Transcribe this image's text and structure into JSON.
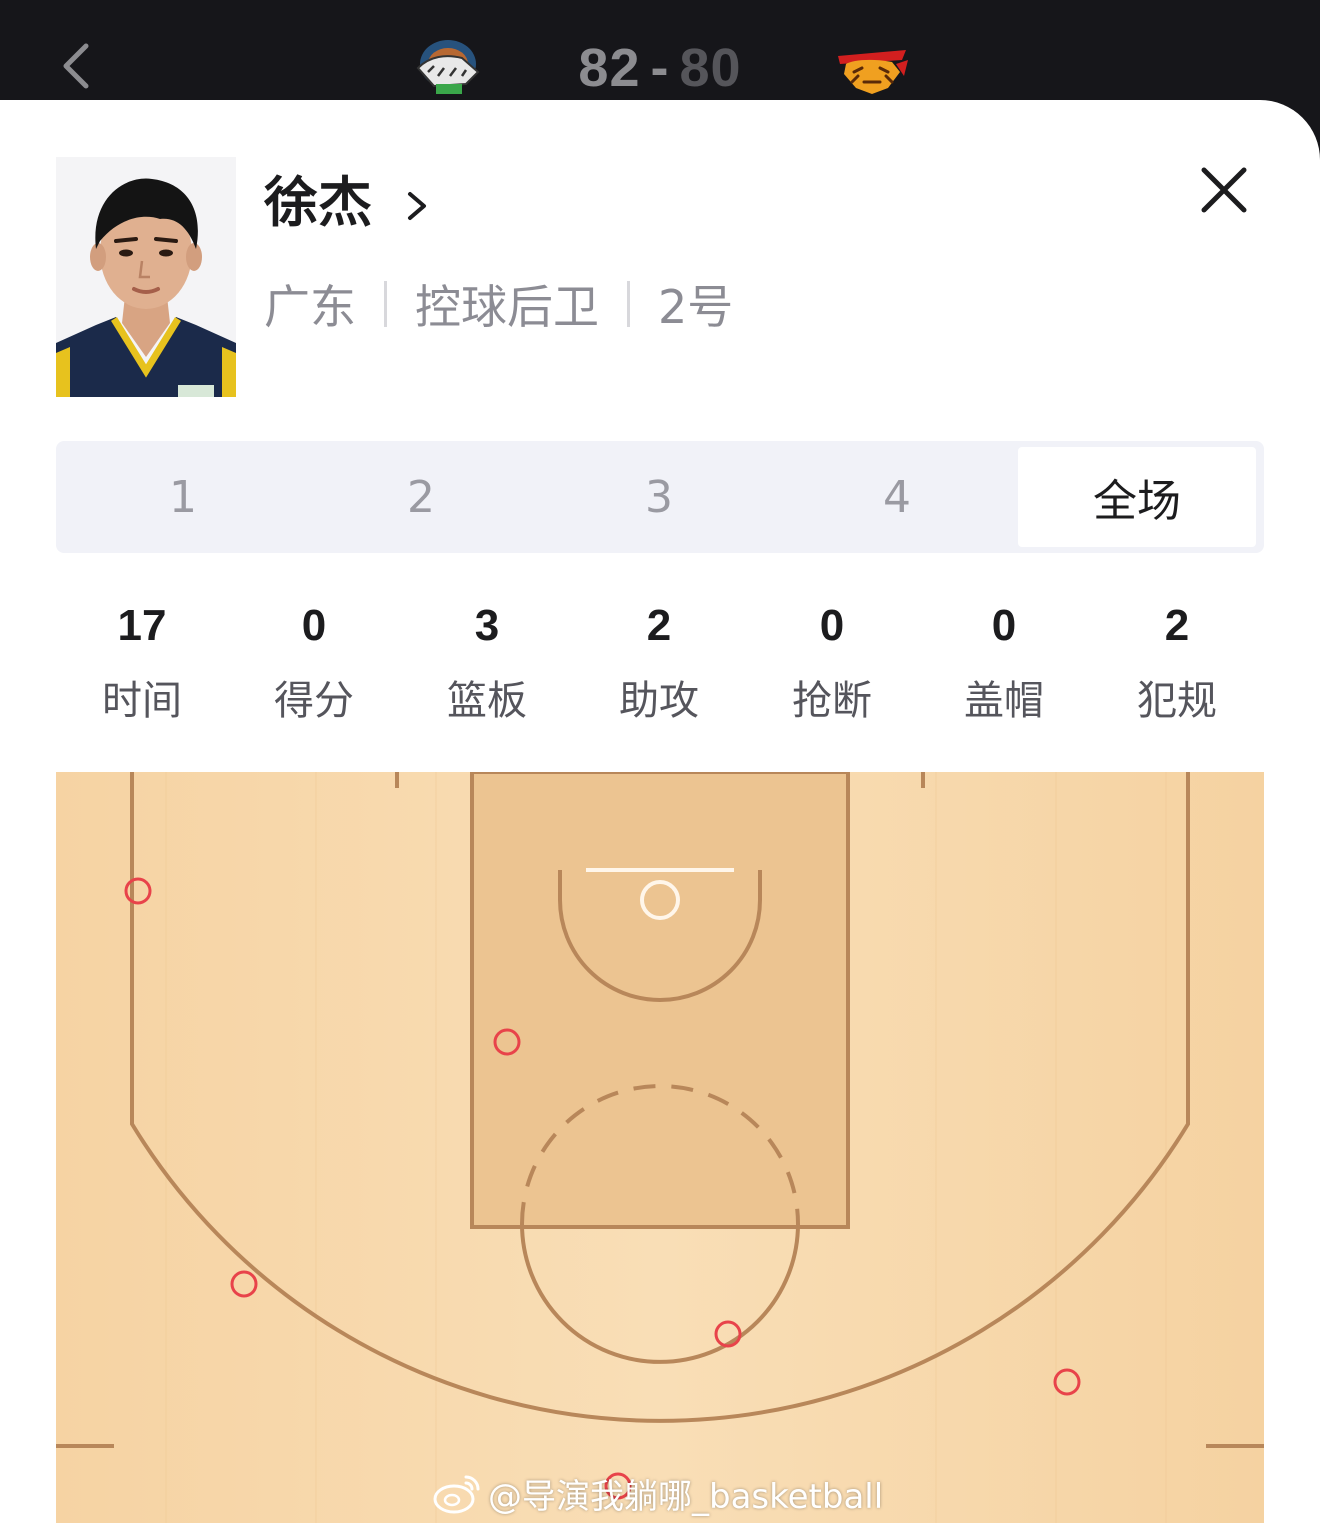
{
  "header": {
    "home_score": "82",
    "separator": "-",
    "away_score": "80",
    "home_team_logo": "tiger-team-logo",
    "away_team_logo": "guangdong-tigers-logo",
    "back_icon": "chevron-left-icon"
  },
  "player": {
    "name": "徐杰",
    "team": "广东",
    "position": "控球后卫",
    "number": "2号",
    "chevron_icon": "chevron-right-icon",
    "close_icon": "close-icon"
  },
  "tabs": [
    {
      "label": "1",
      "active": false
    },
    {
      "label": "2",
      "active": false
    },
    {
      "label": "3",
      "active": false
    },
    {
      "label": "4",
      "active": false
    },
    {
      "label": "全场",
      "active": true
    }
  ],
  "stats": [
    {
      "value": "17",
      "label": "时间"
    },
    {
      "value": "0",
      "label": "得分"
    },
    {
      "value": "3",
      "label": "篮板"
    },
    {
      "value": "2",
      "label": "助攻"
    },
    {
      "value": "0",
      "label": "抢断"
    },
    {
      "value": "0",
      "label": "盖帽"
    },
    {
      "value": "2",
      "label": "犯规"
    }
  ],
  "shot_chart": {
    "missed_shot_color": "#e8434a",
    "court_color": "#f7d9ae",
    "line_color": "#b8875a",
    "missed_shots": 6
  },
  "watermark": {
    "text": "@导演我躺哪_basketball",
    "icon": "weibo-icon"
  }
}
